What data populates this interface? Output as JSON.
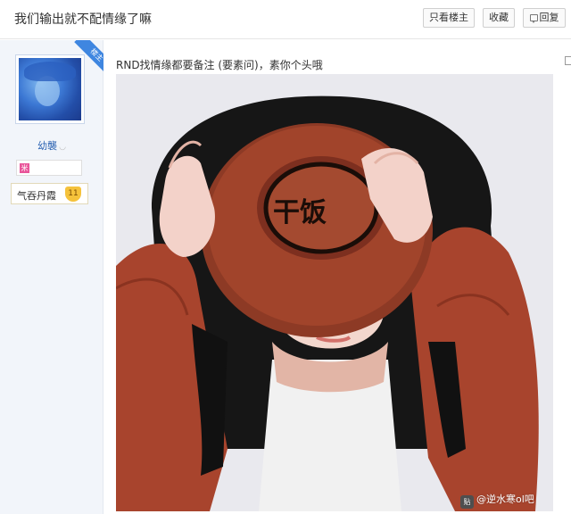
{
  "thread": {
    "title": "我们输出就不配情缘了嘛",
    "only_op_label": "只看楼主",
    "favorite_label": "收藏",
    "reply_label": "回复"
  },
  "author": {
    "op_ribbon": "楼主",
    "username": "幼襲",
    "badge_icon": "米",
    "rank_name": "气吞丹霞",
    "rank_level": "11"
  },
  "post": {
    "text": "RND找情缘都要备注 (要素问)，素你个头哦",
    "image_stamp_text": "干饭",
    "watermark_icon": "贴",
    "watermark_text": "@逆水寒ol吧"
  },
  "colors": {
    "accent_blue": "#3f86e0",
    "link_blue": "#2d64b3",
    "sweater": "#a8442d",
    "bowl": "#9a3e27"
  }
}
